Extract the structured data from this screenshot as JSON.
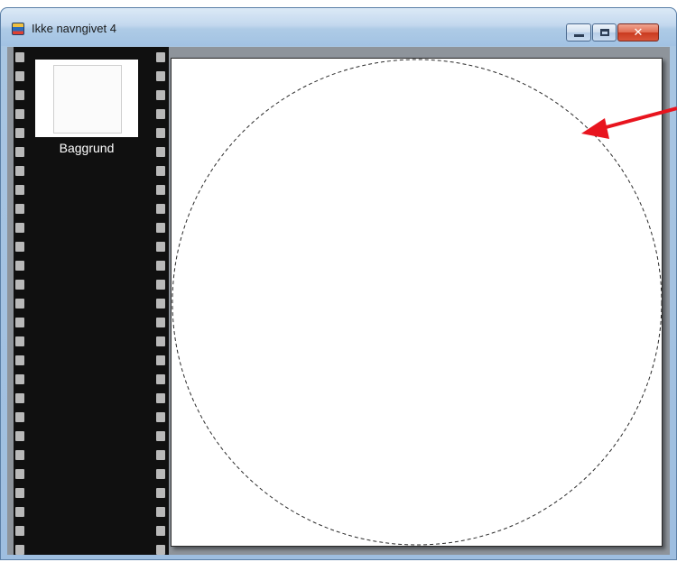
{
  "window": {
    "title": "Ikke navngivet 4",
    "icon": "image-document-icon",
    "controls": {
      "minimize_icon": "minimize-icon",
      "maximize_icon": "maximize-icon",
      "close_icon": "close-icon",
      "close_glyph": "✕"
    }
  },
  "layers_panel": {
    "layers": [
      {
        "label": "Baggrund",
        "selected": true
      }
    ]
  },
  "canvas": {
    "background": "#ffffff",
    "selection_shape": "ellipse",
    "selection_style": "dashed marquee"
  },
  "annotation": {
    "type": "arrow",
    "color": "#e8141e"
  }
}
